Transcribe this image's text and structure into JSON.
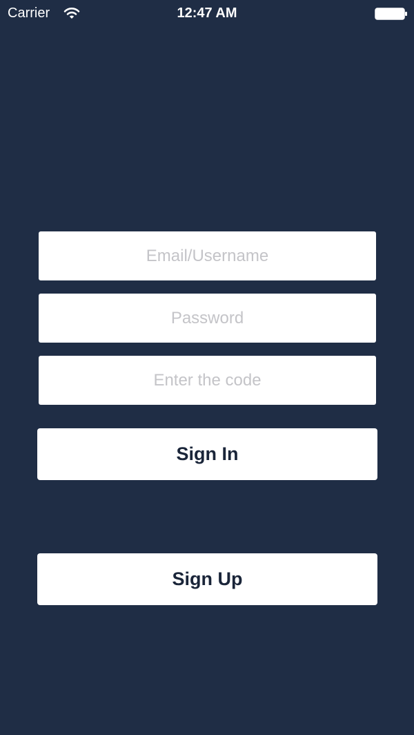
{
  "status_bar": {
    "carrier": "Carrier",
    "time": "12:47 AM",
    "wifi_icon": "wifi-icon",
    "battery_icon": "battery-icon"
  },
  "form": {
    "email": {
      "value": "",
      "placeholder": "Email/Username"
    },
    "password": {
      "value": "",
      "placeholder": "Password"
    },
    "code": {
      "value": "",
      "placeholder": "Enter the code"
    }
  },
  "buttons": {
    "sign_in": "Sign In",
    "sign_up": "Sign Up"
  },
  "colors": {
    "background": "#1f2d45",
    "button_text": "#1a2539",
    "placeholder": "#c4c4c8",
    "field_bg": "#ffffff"
  }
}
